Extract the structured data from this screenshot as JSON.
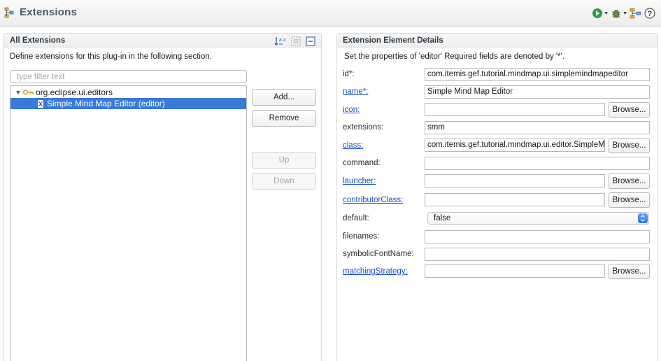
{
  "header": {
    "title": "Extensions",
    "tools": [
      {
        "name": "run-icon",
        "has_dropdown": true
      },
      {
        "name": "debug-icon",
        "has_dropdown": true
      },
      {
        "name": "hierarchy-icon"
      },
      {
        "name": "help-icon",
        "glyph": "?"
      }
    ]
  },
  "left": {
    "title": "All Extensions",
    "toolbar_icons": [
      "sort-icon",
      "show-full-names-icon",
      "collapse-all-icon"
    ],
    "sort_icon_text": "a z",
    "description": "Define extensions for this plug-in in the following section.",
    "filter_placeholder": "type filter text",
    "tree": [
      {
        "label": "org.eclipse.ui.editors",
        "expanded": true,
        "selected": false
      },
      {
        "label": "Simple Mind Map Editor (editor)",
        "expanded": false,
        "selected": true
      }
    ],
    "buttons": {
      "add": "Add...",
      "remove": "Remove",
      "up": "Up",
      "down": "Down"
    }
  },
  "right": {
    "title": "Extension Element Details",
    "description": "Set the properties of 'editor' Required fields are denoted by '*'.",
    "browse_label": "Browse...",
    "fields": {
      "id": {
        "label": "id*:",
        "value": "com.itemis.gef.tutorial.mindmap.ui.simplemindmapeditor"
      },
      "name": {
        "label": "name*:",
        "value": "Simple Mind Map Editor"
      },
      "icon": {
        "label": "icon:",
        "value": ""
      },
      "extensions": {
        "label": "extensions:",
        "value": "smm"
      },
      "class": {
        "label": "class:",
        "value": "com.itemis.gef.tutorial.mindmap.ui.editor.SimpleMindMapEditor"
      },
      "command": {
        "label": "command:",
        "value": ""
      },
      "launcher": {
        "label": "launcher:",
        "value": ""
      },
      "contributorClass": {
        "label": "contributorClass:",
        "value": ""
      },
      "default": {
        "label": "default:",
        "value": "false"
      },
      "filenames": {
        "label": "filenames:",
        "value": ""
      },
      "symbolicFontName": {
        "label": "symbolicFontName:",
        "value": ""
      },
      "matchingStrategy": {
        "label": "matchingStrategy:",
        "value": ""
      }
    }
  },
  "colors": {
    "selection": "#3879d9",
    "link": "#1a4fd6",
    "header_title": "#4d5a68"
  }
}
